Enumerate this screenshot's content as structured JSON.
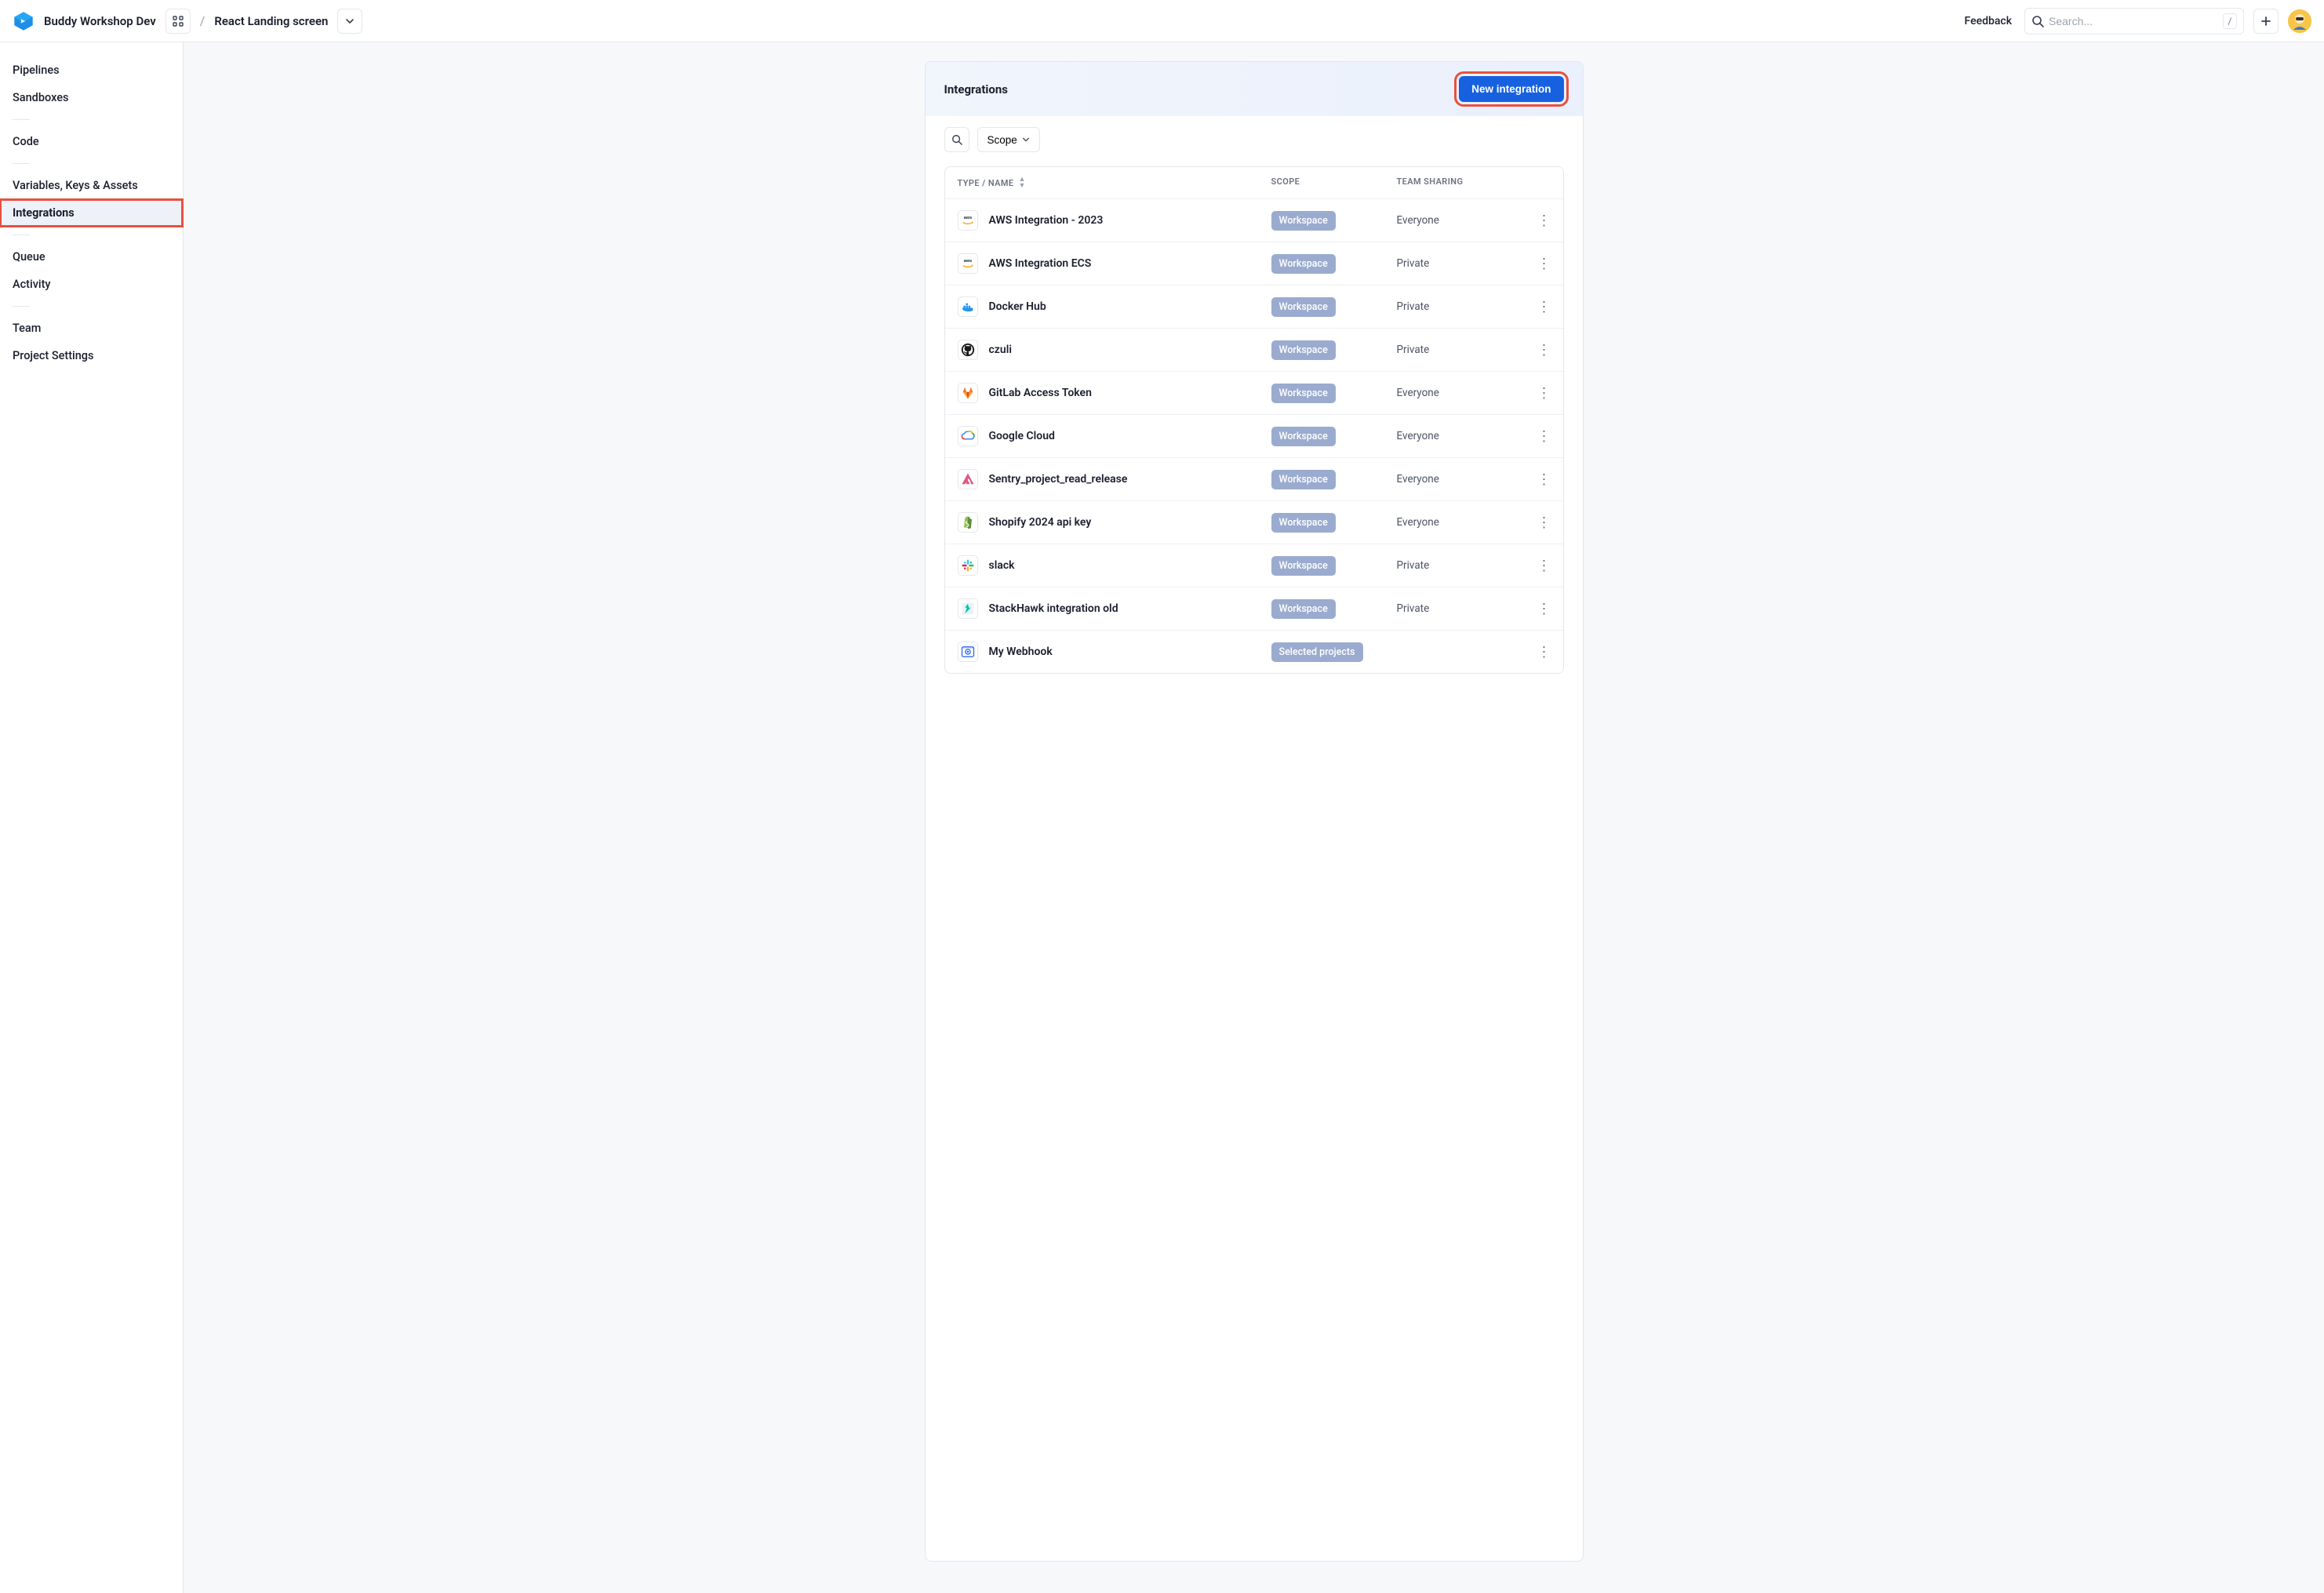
{
  "header": {
    "workspace_name": "Buddy Workshop Dev",
    "project_name": "React Landing screen",
    "feedback_label": "Feedback",
    "search_placeholder": "Search..."
  },
  "sidebar": {
    "items": [
      {
        "label": "Pipelines",
        "active": false
      },
      {
        "label": "Sandboxes",
        "active": false
      },
      {
        "label": "Code",
        "active": false
      },
      {
        "label": "Variables, Keys & Assets",
        "active": false
      },
      {
        "label": "Integrations",
        "active": true
      },
      {
        "label": "Queue",
        "active": false
      },
      {
        "label": "Activity",
        "active": false
      },
      {
        "label": "Team",
        "active": false
      },
      {
        "label": "Project Settings",
        "active": false
      }
    ],
    "separators_after": [
      1,
      2,
      4,
      6
    ]
  },
  "panel": {
    "title": "Integrations",
    "new_button_label": "New integration",
    "scope_filter_label": "Scope",
    "columns": {
      "type_name": "TYPE / NAME",
      "scope": "SCOPE",
      "team_sharing": "TEAM SHARING"
    },
    "rows": [
      {
        "name": "AWS Integration - 2023",
        "icon": "aws",
        "scope": "Workspace",
        "sharing": "Everyone"
      },
      {
        "name": "AWS Integration ECS",
        "icon": "aws",
        "scope": "Workspace",
        "sharing": "Private"
      },
      {
        "name": "Docker Hub",
        "icon": "docker",
        "scope": "Workspace",
        "sharing": "Private"
      },
      {
        "name": "czuli",
        "icon": "github",
        "scope": "Workspace",
        "sharing": "Private"
      },
      {
        "name": "GitLab Access Token",
        "icon": "gitlab",
        "scope": "Workspace",
        "sharing": "Everyone"
      },
      {
        "name": "Google Cloud",
        "icon": "gcloud",
        "scope": "Workspace",
        "sharing": "Everyone"
      },
      {
        "name": "Sentry_project_read_release",
        "icon": "sentry",
        "scope": "Workspace",
        "sharing": "Everyone"
      },
      {
        "name": "Shopify 2024 api key",
        "icon": "shopify",
        "scope": "Workspace",
        "sharing": "Everyone"
      },
      {
        "name": "slack",
        "icon": "slack",
        "scope": "Workspace",
        "sharing": "Private"
      },
      {
        "name": "StackHawk integration old",
        "icon": "stackhawk",
        "scope": "Workspace",
        "sharing": "Private"
      },
      {
        "name": "My Webhook",
        "icon": "webhook",
        "scope": "Selected projects",
        "sharing": ""
      }
    ]
  }
}
